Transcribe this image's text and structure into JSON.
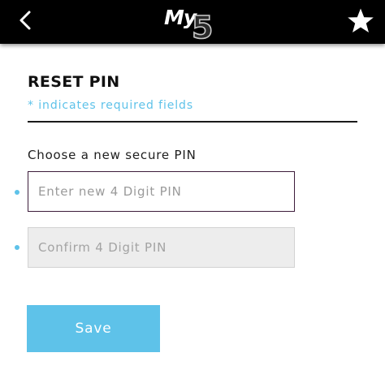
{
  "header": {
    "logo_text": "My5",
    "back_icon": "chevron-left-icon",
    "favourite_icon": "star-icon",
    "background": "#000000"
  },
  "form": {
    "title": "RESET PIN",
    "required_note": "* indicates required fields",
    "section_label": "Choose a new secure PIN",
    "new_pin": {
      "placeholder": "Enter new 4 Digit PIN",
      "value": ""
    },
    "confirm_pin": {
      "placeholder": "Confirm 4 Digit PIN",
      "value": ""
    },
    "save_label": "Save"
  },
  "colors": {
    "accent": "#5ec2e9",
    "focused_border": "#3d1c3b",
    "disabled_field": "#ededed"
  }
}
